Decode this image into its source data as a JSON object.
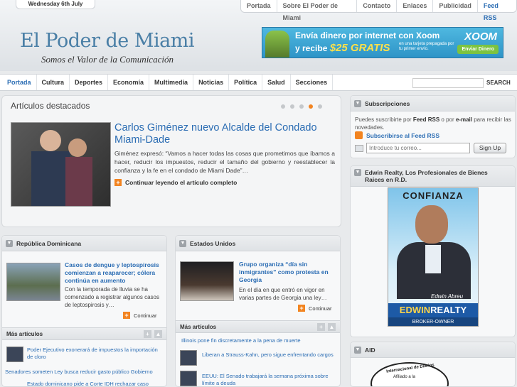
{
  "header": {
    "date": "Wednesday 6th July",
    "topnav": [
      "Portada",
      "Sobre El Poder de Miami",
      "Contacto",
      "Enlaces",
      "Publicidad",
      "Feed RSS"
    ],
    "logo": "El Poder de Miami",
    "tagline": "Somos el Valor de la Comunicación",
    "ad": {
      "line1": "Envía dinero por internet con Xoom",
      "line2": "y recibe",
      "amount": "$25 GRATIS",
      "small": "en una tarjeta prepagada por tu primer envío.",
      "brand": "XOOM",
      "button": "Enviar Dinero"
    }
  },
  "mainnav": {
    "items": [
      "Portada",
      "Cultura",
      "Deportes",
      "Economía",
      "Multimedia",
      "Noticias",
      "Política",
      "Salud",
      "Secciones"
    ],
    "active": "Portada",
    "search_button": "SEARCH"
  },
  "featured": {
    "heading": "Artículos destacados",
    "slides": 5,
    "active_slide": 4,
    "title": "Carlos Giménez nuevo Alcalde del Condado Miami-Dade",
    "text": "Giménez expresó: “Vamos a hacer todas las cosas que prometimos que íbamos a hacer, reducir los impuestos, reducir el tamaño del gobierno y reestablecer la confianza y la fe en el condado de Miami Dade”…",
    "more": "Continuar leyendo el artículo completo"
  },
  "col1": {
    "heading": "República Dominicana",
    "title": "Casos de dengue y leptospirosis comienzan a reaparecer; cólera continúa en aumento",
    "text": "Con la temporada de lluvia se ha comenzado a registrar algunos casos de leptospirosis y…",
    "more": "Continuar",
    "more_articles": "Más artículos",
    "list": [
      "Poder Ejecutivo exonerará de impuestos la importación de cloro",
      "Senadores someten Ley busca reducir gasto público Gobierno",
      "Estado dominicano pide a Corte IDH rechazar caso"
    ]
  },
  "col2": {
    "heading": "Estados Unidos",
    "title": "Grupo organiza “día sin inmigrantes” como protesta en Georgia",
    "text": "En el día en que entró en vigor en varias partes de Georgia una ley…",
    "more": "Continuar",
    "more_articles": "Más artículos",
    "list": [
      "Illinois pone fin discretamente a la pena de muerte",
      "Liberan a Strauss-Kahn, pero sigue enfrentando cargos",
      "EEUU: El Senado trabajará la semana próxima sobre límite a deuda"
    ]
  },
  "sidebar": {
    "subs_heading": "Subscripciones",
    "subs_text_1": "Puedes suscribirte por",
    "subs_feed": "Feed RSS",
    "subs_text_2": "o por",
    "subs_email": "e-mail",
    "subs_text_3": "para recibir las novedades.",
    "rss_link": "Subscribirse al Feed RSS",
    "email_placeholder": "Introduce tu correo...",
    "signup": "Sign Up",
    "edwin_heading": "Edwin Realty, Los Profesionales de Bienes Raices en R.D.",
    "edwin_conf": "CONFIANZA",
    "edwin_sig": "Edwin Abreu",
    "edwin_brand_1": "EDWIN",
    "edwin_brand_2": "REALTY",
    "edwin_bo": "BROKER-OWNER",
    "aid_heading": "AID",
    "aid_t1": "Internacional de Diarios",
    "aid_t2": "Afiliado a la"
  }
}
